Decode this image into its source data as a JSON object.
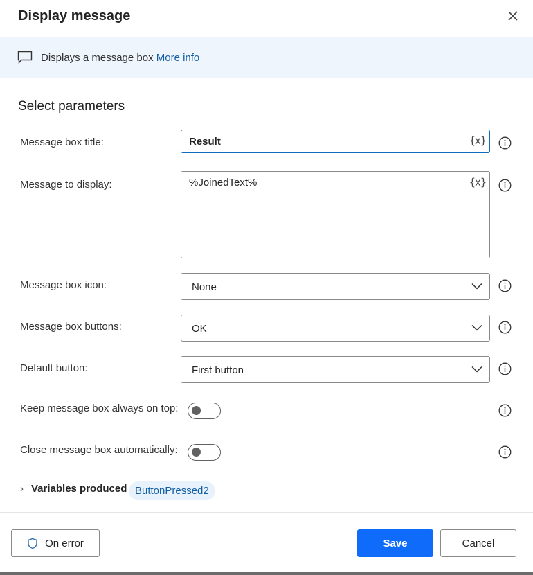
{
  "dialog": {
    "title": "Display message",
    "close_label": "close"
  },
  "banner": {
    "description": "Displays a message box ",
    "link": "More info"
  },
  "section_title": "Select parameters",
  "fields": {
    "title": {
      "label": "Message box title:",
      "value": "Result",
      "var_button": "{x}"
    },
    "message": {
      "label": "Message to display:",
      "value": "%JoinedText%",
      "var_button": "{x}"
    },
    "icon": {
      "label": "Message box icon:",
      "value": "None"
    },
    "buttons": {
      "label": "Message box buttons:",
      "value": "OK"
    },
    "default_button": {
      "label": "Default button:",
      "value": "First button"
    },
    "always_on_top": {
      "label": "Keep message box always on top:",
      "on": false
    },
    "auto_close": {
      "label": "Close message box automatically:",
      "on": false
    }
  },
  "variables": {
    "label": "Variables produced",
    "items": [
      "ButtonPressed2"
    ]
  },
  "footer": {
    "on_error": "On error",
    "save": "Save",
    "cancel": "Cancel"
  },
  "colors": {
    "accent": "#0f6cfa",
    "link": "#115ea3",
    "banner_bg": "#eff5fc",
    "chip_bg": "#e8f2fc"
  }
}
